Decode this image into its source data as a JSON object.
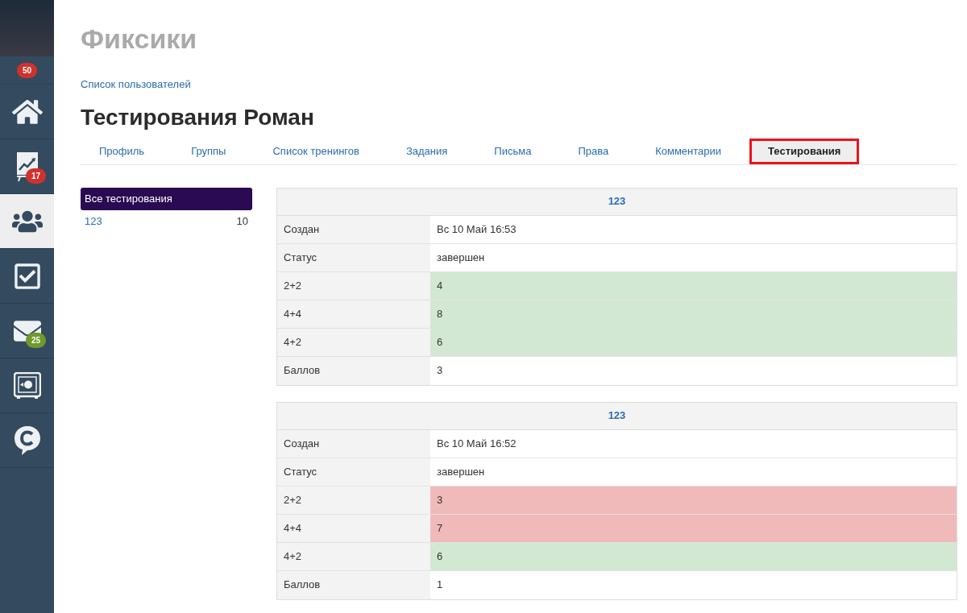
{
  "sidebar": {
    "profile_badge": {
      "text": "50",
      "color": "#d0312d"
    },
    "items": [
      {
        "selected": false
      },
      {
        "selected": false,
        "badge": {
          "text": "17",
          "color": "#d0312d"
        }
      },
      {
        "selected": true
      },
      {
        "selected": false
      },
      {
        "selected": false,
        "badge": {
          "text": "25",
          "color": "#6f9a2c"
        }
      },
      {
        "selected": false
      },
      {
        "selected": false
      }
    ]
  },
  "site_title": "Фиксики",
  "breadcrumb": "Список пользователей",
  "page_title": "Тестирования Роман",
  "tabs": [
    {
      "label": "Профиль",
      "selected": false,
      "highlighted": false
    },
    {
      "label": "Группы",
      "selected": false,
      "highlighted": false
    },
    {
      "label": "Список тренингов",
      "selected": false,
      "highlighted": false
    },
    {
      "label": "Задания",
      "selected": false,
      "highlighted": false
    },
    {
      "label": "Письма",
      "selected": false,
      "highlighted": false
    },
    {
      "label": "Права",
      "selected": false,
      "highlighted": false
    },
    {
      "label": "Комментарии",
      "selected": false,
      "highlighted": false
    },
    {
      "label": "Тестирования",
      "selected": true,
      "highlighted": true
    }
  ],
  "filter": {
    "items": [
      {
        "label": "Все тестирования",
        "selected": true
      },
      {
        "label": "123",
        "count": "10",
        "selected": false
      }
    ]
  },
  "tests": [
    {
      "title": "123",
      "rows": [
        {
          "kind": "info",
          "label": "Создан",
          "value": "Вс 10 Май 16:53"
        },
        {
          "kind": "info",
          "label": "Статус",
          "value": "завершен"
        },
        {
          "kind": "answer",
          "label": "2+2",
          "value": "4",
          "correct": true
        },
        {
          "kind": "answer",
          "label": "4+4",
          "value": "8",
          "correct": true
        },
        {
          "kind": "answer",
          "label": "4+2",
          "value": "6",
          "correct": true
        },
        {
          "kind": "info",
          "label": "Баллов",
          "value": "3"
        }
      ]
    },
    {
      "title": "123",
      "rows": [
        {
          "kind": "info",
          "label": "Создан",
          "value": "Вс 10 Май 16:52"
        },
        {
          "kind": "info",
          "label": "Статус",
          "value": "завершен"
        },
        {
          "kind": "answer",
          "label": "2+2",
          "value": "3",
          "correct": false
        },
        {
          "kind": "answer",
          "label": "4+4",
          "value": "7",
          "correct": false
        },
        {
          "kind": "answer",
          "label": "4+2",
          "value": "6",
          "correct": true
        },
        {
          "kind": "info",
          "label": "Баллов",
          "value": "1"
        }
      ]
    }
  ]
}
